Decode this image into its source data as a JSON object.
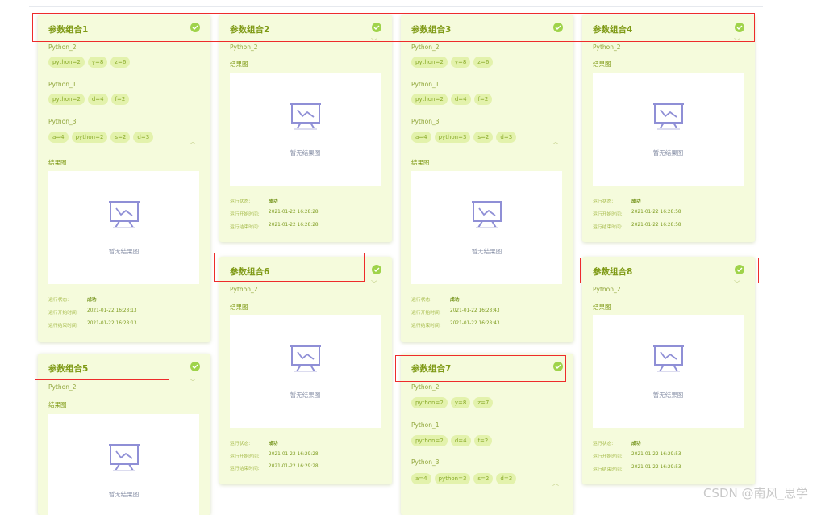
{
  "labels": {
    "result": "结果图",
    "empty": "暂无结果图",
    "status_key": "运行状态:",
    "start_key": "运行开始时间:",
    "end_key": "运行结束时间:"
  },
  "colors": {
    "card_bg": "#f5fbdc",
    "title": "#7f9a16",
    "tag_bg": "#e3f2ac",
    "success": "#9fd34a",
    "highlight": "#ee2b2b"
  },
  "icons": {
    "success": "check-circle-icon",
    "collapse": "chevron-icon",
    "empty": "presentation-board-icon"
  },
  "cards": [
    {
      "title": "参数组合1",
      "sections": [
        {
          "name": "Python_2",
          "params": [
            "python=2",
            "y=8",
            "z=6"
          ]
        },
        {
          "name": "Python_1",
          "params": [
            "python=2",
            "d=4",
            "f=2"
          ]
        },
        {
          "name": "Python_3",
          "params": [
            "a=4",
            "python=2",
            "s=2",
            "d=3"
          ]
        }
      ],
      "status": "成功",
      "start": "2021-01-22 16:28:13",
      "end": "2021-01-22 16:28:13"
    },
    {
      "title": "参数组合2",
      "sections": [
        {
          "name": "Python_2"
        }
      ],
      "status": "成功",
      "start": "2021-01-22 16:28:28",
      "end": "2021-01-22 16:28:28"
    },
    {
      "title": "参数组合3",
      "sections": [
        {
          "name": "Python_2",
          "params": [
            "python=2",
            "y=8",
            "z=6"
          ]
        },
        {
          "name": "Python_1",
          "params": [
            "python=2",
            "d=4",
            "f=2"
          ]
        },
        {
          "name": "Python_3",
          "params": [
            "a=4",
            "python=3",
            "s=2",
            "d=3"
          ]
        }
      ],
      "status": "成功",
      "start": "2021-01-22 16:28:43",
      "end": "2021-01-22 16:28:43"
    },
    {
      "title": "参数组合4",
      "sections": [
        {
          "name": "Python_2"
        }
      ],
      "status": "成功",
      "start": "2021-01-22 16:28:58",
      "end": "2021-01-22 16:28:58"
    },
    {
      "title": "参数组合5",
      "sections": [
        {
          "name": "Python_2"
        }
      ]
    },
    {
      "title": "参数组合6",
      "sections": [
        {
          "name": "Python_2"
        }
      ],
      "status": "成功",
      "start": "2021-01-22 16:29:28",
      "end": "2021-01-22 16:29:28"
    },
    {
      "title": "参数组合7",
      "sections": [
        {
          "name": "Python_2",
          "params": [
            "python=2",
            "y=8",
            "z=7"
          ]
        },
        {
          "name": "Python_1",
          "params": [
            "python=2",
            "d=4",
            "f=2"
          ]
        },
        {
          "name": "Python_3",
          "params": [
            "a=4",
            "python=3",
            "s=2",
            "d=3"
          ]
        }
      ]
    },
    {
      "title": "参数组合8",
      "sections": [
        {
          "name": "Python_2"
        }
      ],
      "status": "成功",
      "start": "2021-01-22 16:29:53",
      "end": "2021-01-22 16:29:53"
    }
  ],
  "watermark": "CSDN @南风_思学"
}
